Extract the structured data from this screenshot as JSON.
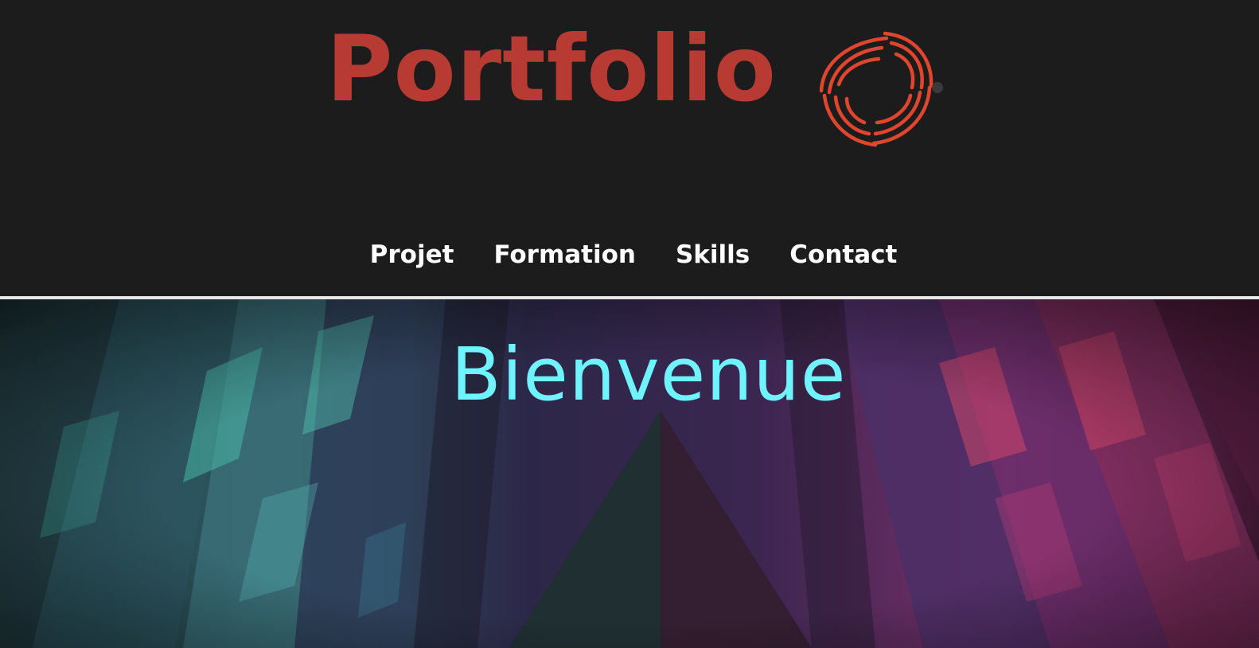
{
  "brand": {
    "title": "Portfolio",
    "logo_icon": "swirl-logo-icon",
    "title_color": "#b83b33",
    "logo_color": "#e0452e"
  },
  "nav": {
    "items": [
      {
        "label": "Projet"
      },
      {
        "label": "Formation"
      },
      {
        "label": "Skills"
      },
      {
        "label": "Contact"
      }
    ]
  },
  "hero": {
    "title": "Bienvenue",
    "title_color": "#6ff4ff"
  },
  "colors": {
    "header_bg": "#1c1c1c",
    "divider": "#e6e6e6",
    "hero_teal": "#4fc7b3",
    "hero_purple": "#6a3a86",
    "hero_pink": "#d23a6a"
  }
}
